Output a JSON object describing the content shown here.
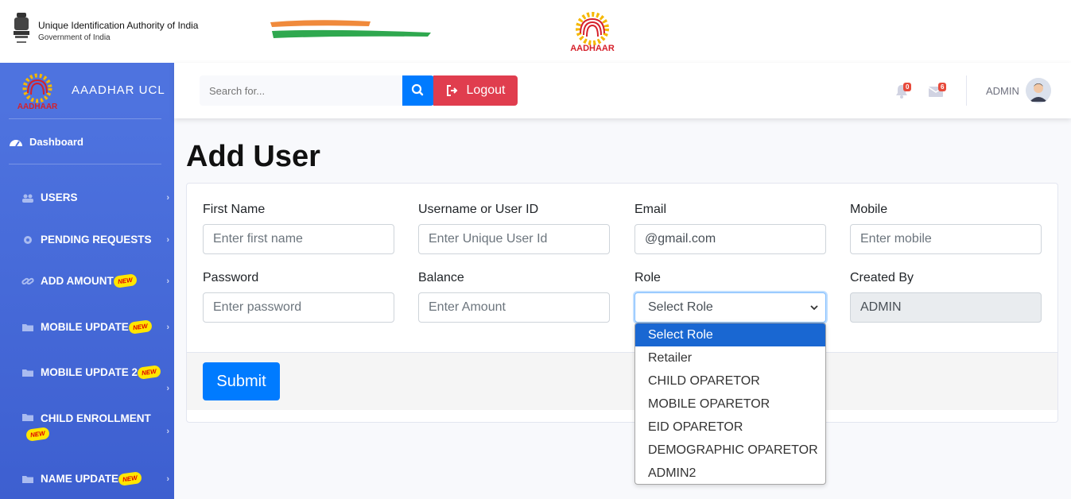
{
  "gov_header": {
    "title": "Unique Identification Authority of India",
    "subtitle": "Government of India",
    "logo_text": "AADHAAR"
  },
  "sidebar": {
    "brand_name": "AAADHAR UCL",
    "brand_logo_text": "AADHAAR",
    "dashboard_label": "Dashboard",
    "new_badge": "NEW",
    "items": [
      {
        "label": "USERS",
        "icon": "users-icon",
        "new": false
      },
      {
        "label": "PENDING REQUESTS",
        "icon": "gear-icon",
        "new": false
      },
      {
        "label": "ADD AMOUNT",
        "icon": "link-icon",
        "new": true
      },
      {
        "label": "MOBILE UPDATE",
        "icon": "folder-icon",
        "new": true
      },
      {
        "label": "MOBILE UPDATE 2",
        "icon": "folder-icon",
        "new": true
      },
      {
        "label": "CHILD ENROLLMENT",
        "icon": "folder-icon",
        "new": true
      },
      {
        "label": "NAME UPDATE",
        "icon": "folder-icon",
        "new": true
      }
    ]
  },
  "topbar": {
    "search_placeholder": "Search for...",
    "logout_label": "Logout",
    "alerts_count": "0",
    "messages_count": "6",
    "user_name": "ADMIN"
  },
  "form": {
    "title": "Add User",
    "fields": {
      "first_name": {
        "label": "First Name",
        "placeholder": "Enter first name"
      },
      "username": {
        "label": "Username or User ID",
        "placeholder": "Enter Unique User Id"
      },
      "email": {
        "label": "Email",
        "value": "@gmail.com"
      },
      "mobile": {
        "label": "Mobile",
        "placeholder": "Enter mobile"
      },
      "password": {
        "label": "Password",
        "placeholder": "Enter password"
      },
      "balance": {
        "label": "Balance",
        "placeholder": "Enter Amount"
      },
      "role": {
        "label": "Role",
        "value": "Select Role"
      },
      "created_by": {
        "label": "Created By",
        "value": "ADMIN"
      }
    },
    "submit_label": "Submit",
    "role_options": [
      "Select Role",
      "Retailer",
      "CHILD OPARETOR",
      "MOBILE OPARETOR",
      "EID OPARETOR",
      "DEMOGRAPHIC OPARETOR",
      "ADMIN2"
    ]
  },
  "colors": {
    "sidebar": "#4e73df",
    "primary": "#007bff",
    "danger": "#e03d4e",
    "selected_option": "#1967d2"
  }
}
